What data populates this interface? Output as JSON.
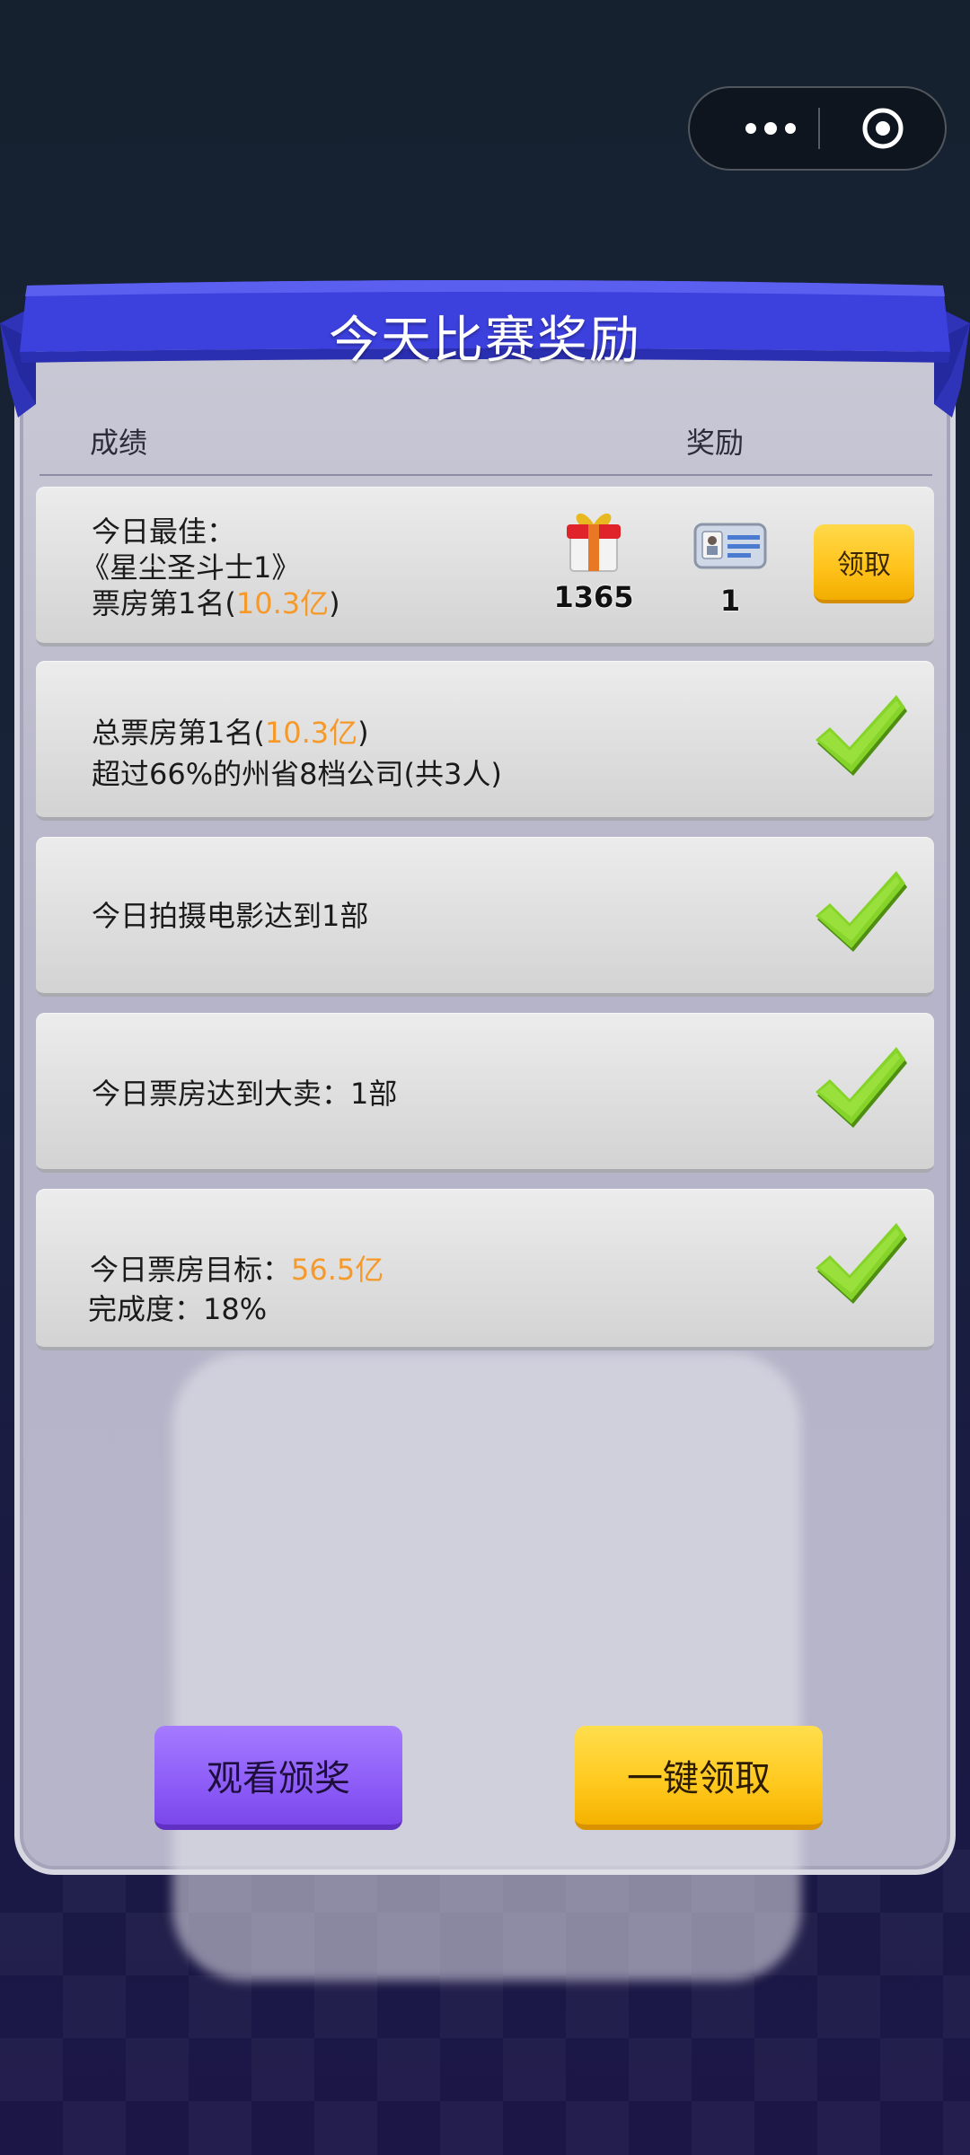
{
  "capsule": {
    "more_icon": "more-dots-icon",
    "close_icon": "target-circle-icon"
  },
  "banner": {
    "title": "今天比赛奖励"
  },
  "headers": {
    "score": "成绩",
    "reward": "奖励"
  },
  "rows": [
    {
      "line1": "今日最佳：",
      "line2": "《星尘圣斗士1》",
      "line3_prefix": "票房第1名(",
      "line3_highlight": "10.3亿",
      "line3_suffix": ")",
      "reward_gift_count": "1365",
      "reward_card_count": "1",
      "claim_label": "领取"
    },
    {
      "line1_prefix": "总票房第1名(",
      "line1_highlight": "10.3亿",
      "line1_suffix": ")",
      "line2": "超过66%的州省8档公司(共3人)"
    },
    {
      "line1": "今日拍摄电影达到1部"
    },
    {
      "line1": "今日票房达到大卖：1部"
    },
    {
      "line1_prefix": "今日票房目标：",
      "line1_highlight": "56.5亿",
      "line2": "完成度：18%"
    }
  ],
  "buttons": {
    "watch": "观看颁奖",
    "claim_all": "一键领取"
  },
  "colors": {
    "banner": "#3a3fd8",
    "highlight": "#f59a2a",
    "check": "#7ed321",
    "yellow_button": "#ffc21a",
    "purple_button": "#8d5cf7"
  }
}
